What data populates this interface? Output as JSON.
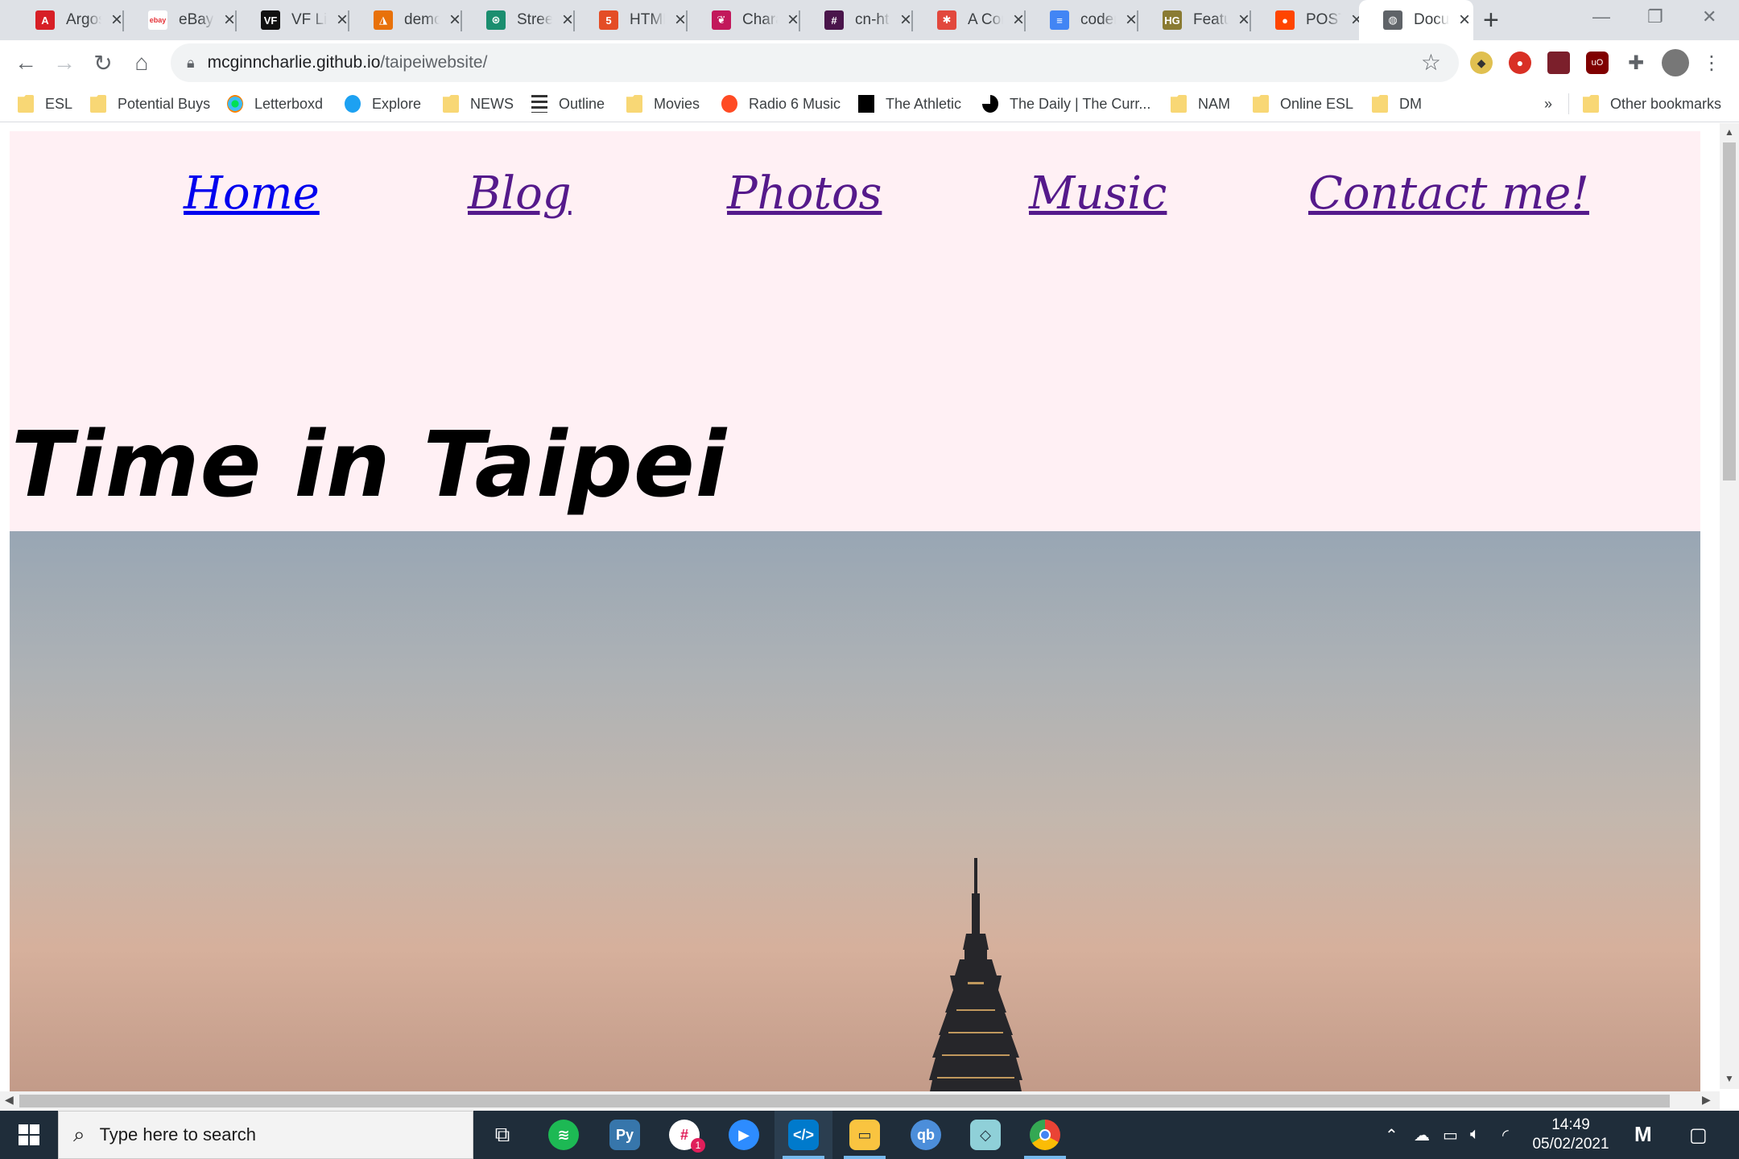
{
  "browser": {
    "tabs": [
      {
        "title": "Argos",
        "icon": "argos-icon",
        "color": "#d71f26",
        "glyph": "A"
      },
      {
        "title": "eBay",
        "icon": "ebay-icon",
        "color": "#ffffff",
        "glyph": "ebay"
      },
      {
        "title": "VF Live",
        "icon": "vf-icon",
        "color": "#111111",
        "glyph": "VF"
      },
      {
        "title": "demo",
        "icon": "demo-icon",
        "color": "#e8710a",
        "glyph": "◮"
      },
      {
        "title": "Street",
        "icon": "street-icon",
        "color": "#1b8e6f",
        "glyph": "⊛"
      },
      {
        "title": "HTML",
        "icon": "html5-icon",
        "color": "#e44d26",
        "glyph": "5"
      },
      {
        "title": "Chara",
        "icon": "bow-icon",
        "color": "#c2185b",
        "glyph": "❦"
      },
      {
        "title": "cn-ht",
        "icon": "slack-icon",
        "color": "#4a154b",
        "glyph": "#"
      },
      {
        "title": "A Con",
        "icon": "asterisk-icon",
        "color": "#e2483d",
        "glyph": "✱"
      },
      {
        "title": "coder",
        "icon": "docs-icon",
        "color": "#4285f4",
        "glyph": "≡"
      },
      {
        "title": "Featu",
        "icon": "hg-icon",
        "color": "#8a7b33",
        "glyph": "HG"
      },
      {
        "title": "POST",
        "icon": "reddit-icon",
        "color": "#ff4500",
        "glyph": "●"
      },
      {
        "title": "Docu",
        "icon": "globe-icon",
        "color": "#5f6368",
        "glyph": "◍",
        "active": true
      }
    ],
    "url_host": "mcginncharlie.github.io",
    "url_path": "/taipeiwebsite/",
    "bookmarks": [
      {
        "label": "ESL",
        "type": "folder"
      },
      {
        "label": "Potential Buys",
        "type": "folder"
      },
      {
        "label": "Letterboxd",
        "type": "letterboxd"
      },
      {
        "label": "Explore",
        "type": "twitter"
      },
      {
        "label": "NEWS",
        "type": "folder"
      },
      {
        "label": "Outline",
        "type": "outline"
      },
      {
        "label": "Movies",
        "type": "folder"
      },
      {
        "label": "Radio 6 Music",
        "type": "radio"
      },
      {
        "label": "The Athletic",
        "type": "athletic"
      },
      {
        "label": "The Daily | The Curr...",
        "type": "daily"
      },
      {
        "label": "NAM",
        "type": "folder"
      },
      {
        "label": "Online ESL",
        "type": "folder"
      },
      {
        "label": "DM",
        "type": "folder"
      }
    ],
    "overflow_label": "»",
    "other_bookmarks": "Other bookmarks"
  },
  "page": {
    "nav": [
      "Home",
      "Blog",
      "Photos",
      "Music",
      "Contact me!"
    ],
    "heading": "Time in Taipei",
    "hero_image": "taipei-101-sunset-photo"
  },
  "taskbar": {
    "search_placeholder": "Type here to search",
    "time": "14:49",
    "date": "05/02/2021",
    "slack_badge": "1"
  }
}
